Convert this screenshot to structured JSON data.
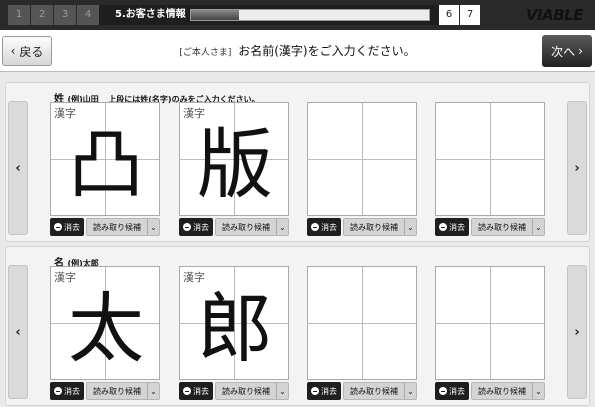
{
  "progress": {
    "steps": [
      "1",
      "2",
      "3",
      "4"
    ],
    "current_step": "5.お客さま情報",
    "future_steps": [
      "6",
      "7"
    ],
    "fraction_complete": 0.2,
    "logo": "VIABLE"
  },
  "header": {
    "back_label": "戻る",
    "next_label": "次へ",
    "tag": "[ご本人さま]",
    "prompt": "お名前(漢字)をご入力ください。"
  },
  "sections": [
    {
      "title": "姓",
      "example": "(例)山田",
      "note": "上段には姓(名字)のみをご入力ください。",
      "cells": [
        {
          "label": "漢字",
          "char": "凸"
        },
        {
          "label": "漢字",
          "char": "版"
        },
        {
          "label": "",
          "char": ""
        },
        {
          "label": "",
          "char": ""
        }
      ]
    },
    {
      "title": "名",
      "example": "(例)太郎",
      "note": "",
      "cells": [
        {
          "label": "漢字",
          "char": "太"
        },
        {
          "label": "漢字",
          "char": "郎"
        },
        {
          "label": "",
          "char": ""
        },
        {
          "label": "",
          "char": ""
        }
      ]
    }
  ],
  "cell_buttons": {
    "clear_label": "消去",
    "candidate_label": "読み取り候補"
  },
  "icons": {
    "left_arrow": "chevron-left-icon",
    "right_arrow": "chevron-right-icon",
    "dropdown": "chevron-down-icon",
    "clear": "minus-circle-icon"
  }
}
